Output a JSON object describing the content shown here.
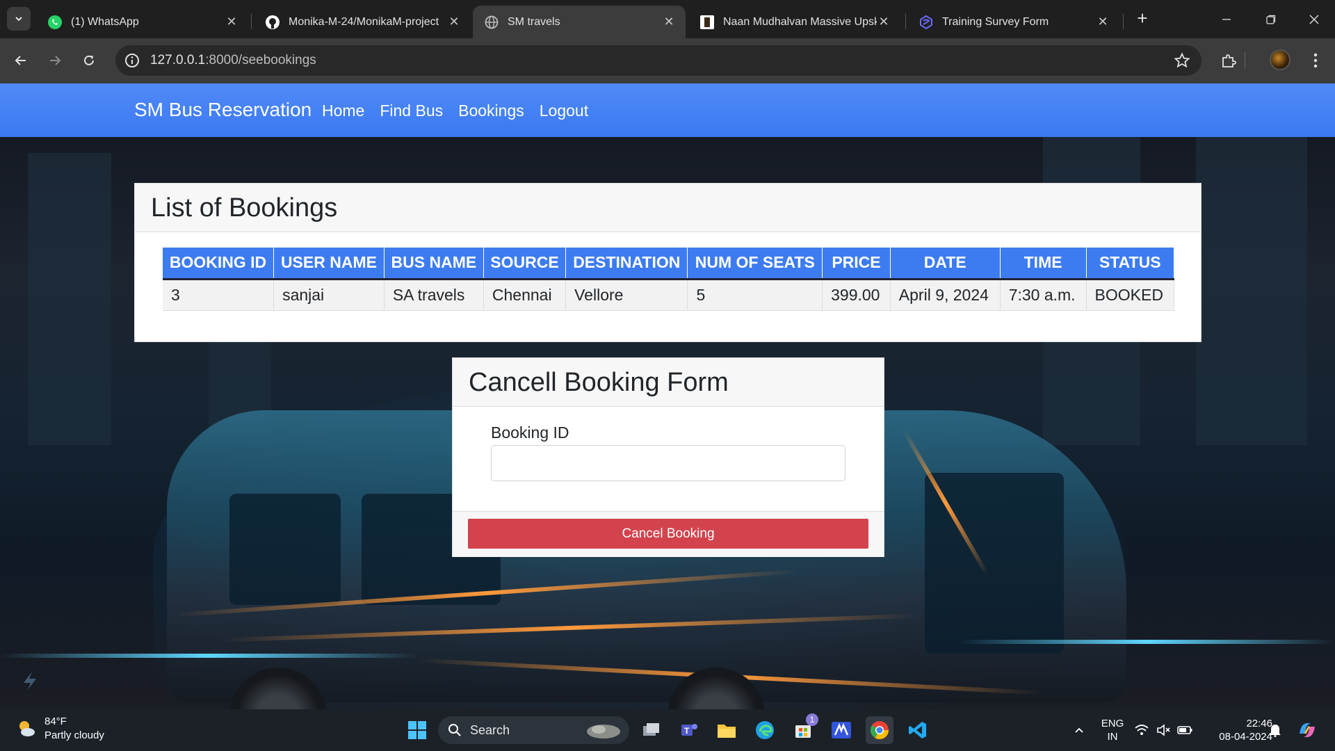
{
  "browser": {
    "tabs": [
      {
        "title": "(1) WhatsApp",
        "icon": "whatsapp-icon"
      },
      {
        "title": "Monika-M-24/MonikaM-project",
        "icon": "github-icon"
      },
      {
        "title": "SM travels",
        "icon": "globe-icon"
      },
      {
        "title": "Naan Mudhalvan Massive Upskil",
        "icon": "naan-mudhalvan-icon"
      },
      {
        "title": "Training Survey Form",
        "icon": "survey-icon"
      }
    ],
    "url_host": "127.0.0.1",
    "url_path": ":8000/seebookings",
    "accent": "#3c3c3c"
  },
  "navbar": {
    "brand": "SM Bus Reservation",
    "links": [
      "Home",
      "Find Bus",
      "Bookings",
      "Logout"
    ],
    "color": "#3d7cf0"
  },
  "bookings": {
    "title": "List of Bookings",
    "columns": [
      "BOOKING ID",
      "USER NAME",
      "BUS NAME",
      "SOURCE",
      "DESTINATION",
      "NUM OF SEATS",
      "PRICE",
      "DATE",
      "TIME",
      "STATUS"
    ],
    "rows": [
      [
        "3",
        "sanjai",
        "SA travels",
        "Chennai",
        "Vellore",
        "5",
        "399.00",
        "April 9, 2024",
        "7:30 a.m.",
        "BOOKED"
      ]
    ]
  },
  "cancel_form": {
    "title": "Cancell Booking Form",
    "label": "Booking ID",
    "value": "",
    "button": "Cancel Booking",
    "button_color": "#d3434d"
  },
  "taskbar": {
    "temperature": "84°F",
    "weather": "Partly cloudy",
    "search": "Search",
    "store_badge": "1",
    "lang": "ENG",
    "region": "IN",
    "time": "22:46",
    "date": "08-04-2024"
  }
}
